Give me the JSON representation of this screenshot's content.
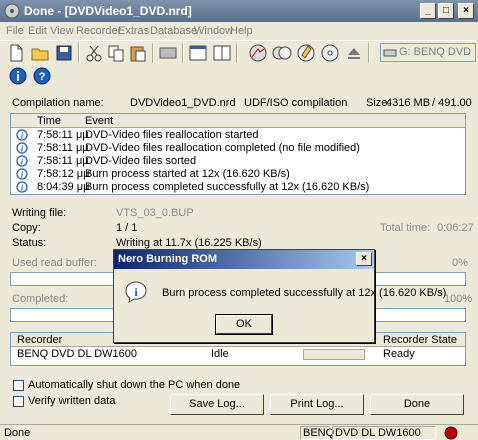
{
  "window": {
    "title": "Done - [DVDVideo1_DVD.nrd]",
    "accent": "#5c6f8c"
  },
  "menu": [
    "File",
    "Edit",
    "View",
    "Recorder",
    "Extras",
    "Database",
    "Window",
    "Help"
  ],
  "toolbar": {
    "drive": "G: BENQ    DVD DL DW"
  },
  "compilation": {
    "name_label": "Compilation name:",
    "name_value": "DVDVideo1_DVD.nrd",
    "type": "UDF/ISO compilation",
    "size_label": "Size:",
    "size_value": "4316 MB",
    "size_total": "/ 491.00"
  },
  "log": {
    "col_time": "Time",
    "col_event": "Event",
    "rows": [
      {
        "time": "7:58:11 μμ",
        "event": "DVD-Video files reallocation started"
      },
      {
        "time": "7:58:11 μμ",
        "event": "DVD-Video files reallocation completed (no file modified)"
      },
      {
        "time": "7:58:11 μμ",
        "event": "DVD-Video files sorted"
      },
      {
        "time": "7:58:12 μμ",
        "event": "Burn process started at 12x (16.620 KB/s)"
      },
      {
        "time": "8:04:39 μμ",
        "event": "Burn process completed successfully at 12x (16.620 KB/s)"
      }
    ]
  },
  "progress": {
    "writing_file_label": "Writing file:",
    "writing_file_value": "VTS_03_0.BUP",
    "copy_label": "Copy:",
    "copy_value": "1 / 1",
    "total_time_label": "Total time:",
    "total_time_value": "0:06:27",
    "status_label": "Status:",
    "status_value": "Writing at 11.7x (16.225 KB/s)",
    "buffer_label": "Used read buffer:",
    "buffer_pct": "0%",
    "completed_label": "Completed:",
    "completed_pct": "100%"
  },
  "recorders": {
    "col_recorder": "Recorder",
    "col_state": "Recorder State",
    "rows": [
      {
        "name": "BENQ  DVD DL DW1600",
        "action": "Idle",
        "state": "Ready"
      }
    ]
  },
  "options": {
    "shutdown": "Automatically shut down the PC when done",
    "verify": "Verify written data"
  },
  "buttons": {
    "save_log": "Save Log...",
    "print_log": "Print Log...",
    "done": "Done"
  },
  "statusbar": {
    "text": "Done",
    "vendor": "BENQ",
    "model": "DVD DL DW1600"
  },
  "dialog": {
    "title": "Nero Burning ROM",
    "message": "Burn process completed successfully at 12x (16.620 KB/s)",
    "ok": "OK"
  }
}
